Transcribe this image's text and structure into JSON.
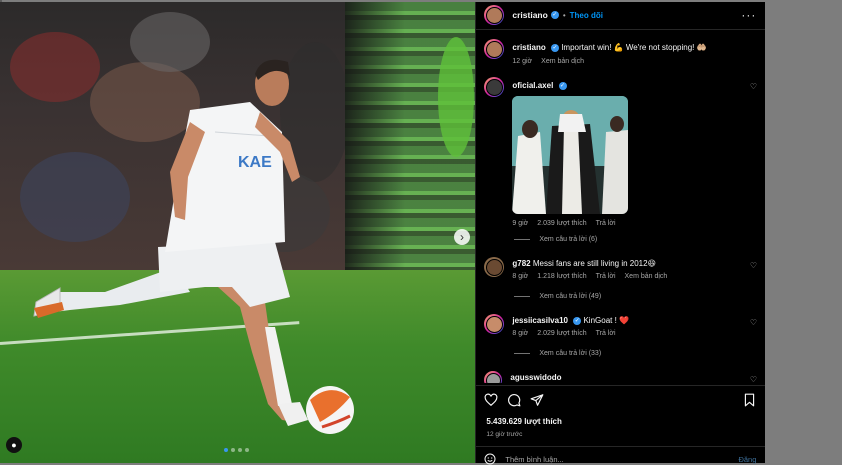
{
  "post": {
    "author": "cristiano",
    "follow_label": "Theo dõi",
    "more_icon": "more-horizontal-icon"
  },
  "caption": {
    "user": "cristiano",
    "text": "Important win! 💪 We're not stopping! 🤲🏼",
    "time": "12 giờ",
    "translate": "Xem bản dịch"
  },
  "comments": [
    {
      "user": "oficial.axel",
      "verified": true,
      "time": "9 giờ",
      "likes": "2.039 lượt thích",
      "reply": "Trả lời",
      "view_replies": "Xem câu trả lời (6)"
    },
    {
      "user": "g782",
      "text": "Messi fans are still living in 2012😆",
      "time": "8 giờ",
      "likes": "1.218 lượt thích",
      "reply": "Trả lời",
      "translate": "Xem bản dịch",
      "view_replies": "Xem câu trả lời (49)"
    },
    {
      "user": "jessiicasilva10",
      "verified": true,
      "text": "KinGoat ! ❤️",
      "time": "8 giờ",
      "likes": "2.029 lượt thích",
      "reply": "Trả lời",
      "view_replies": "Xem câu trả lời (33)"
    },
    {
      "user": "agusswidodo"
    }
  ],
  "footer": {
    "likes": "5.439.629 lượt thích",
    "time": "12 giờ trước",
    "add_comment_placeholder": "Thêm bình luận...",
    "post_button": "Đăng"
  },
  "colors": {
    "accent": "#0095f6",
    "background": "#000000",
    "text": "#f5f5f5",
    "muted": "#a8a8a8"
  }
}
